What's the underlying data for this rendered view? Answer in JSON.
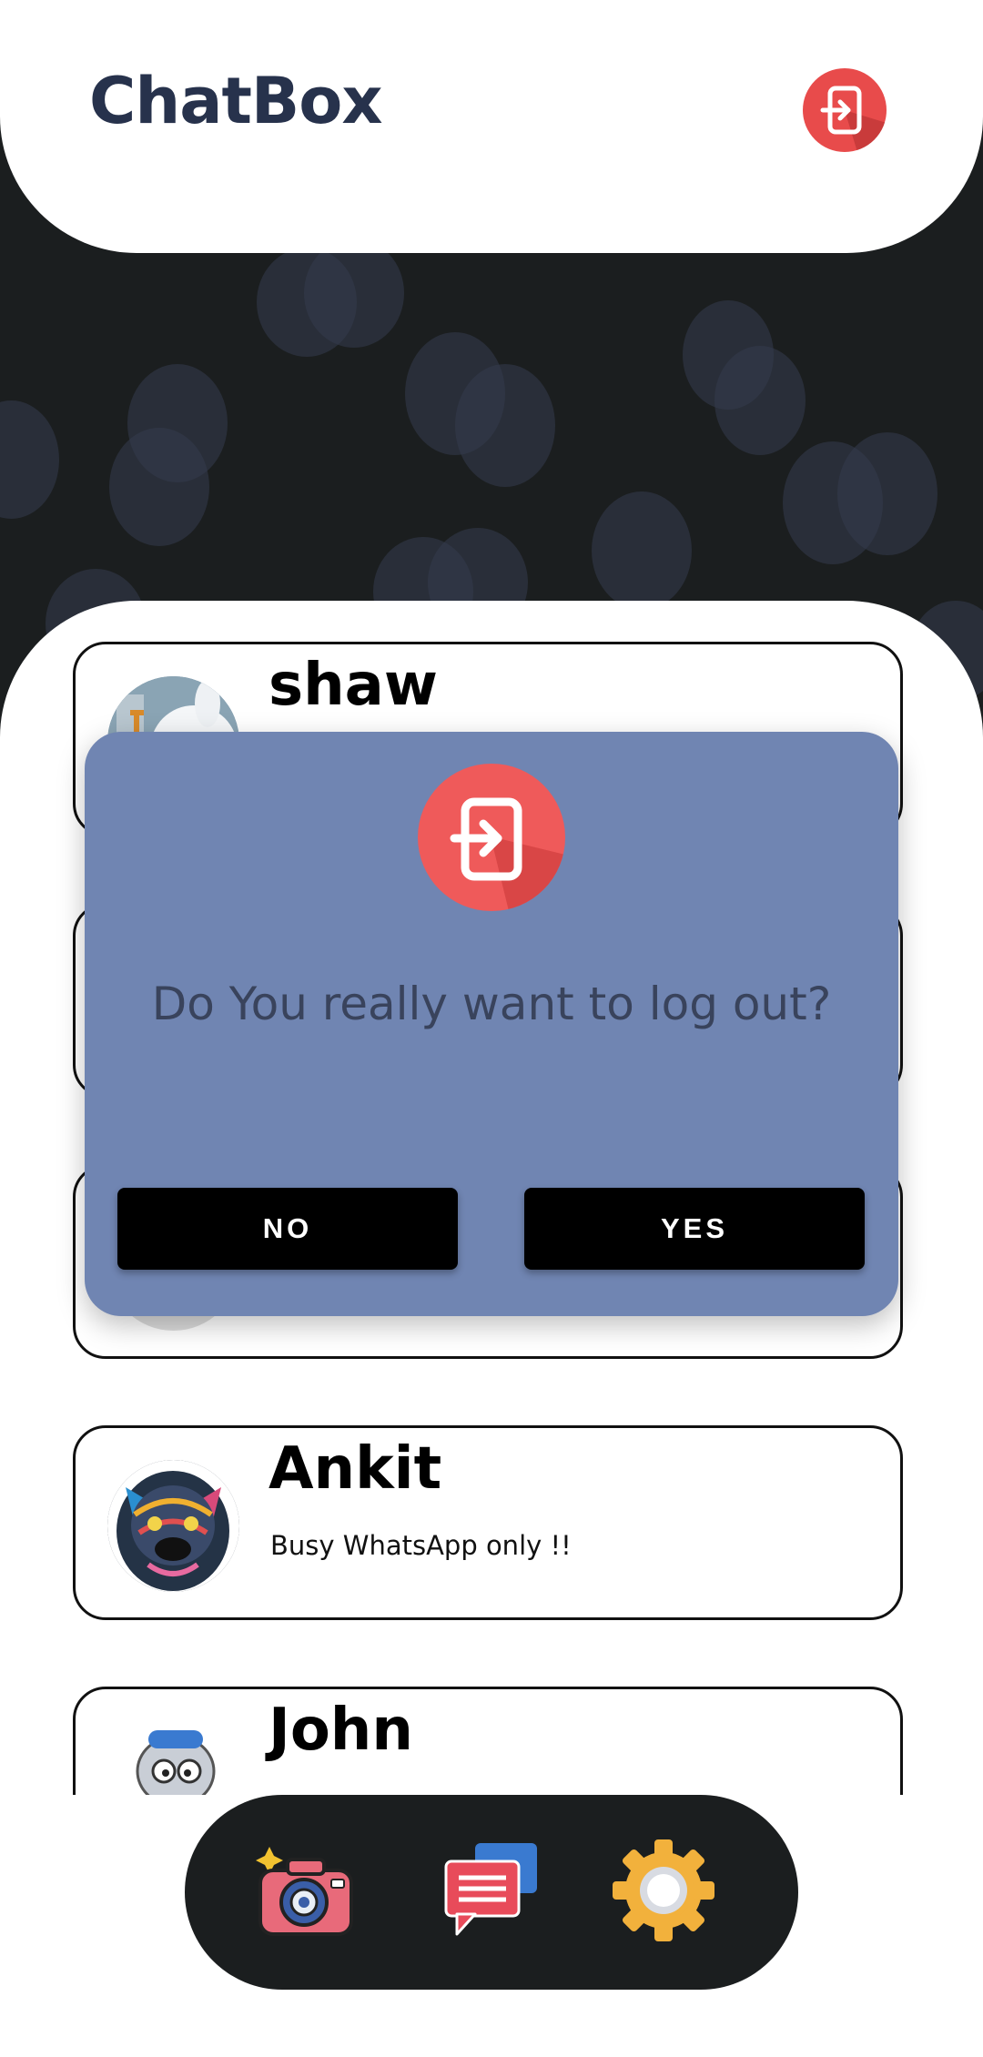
{
  "header": {
    "app_title": "ChatBox",
    "logout_icon": "logout-icon"
  },
  "chats": [
    {
      "name": "shaw",
      "status": "",
      "avatar": "cartoon-rabbit-avatar"
    },
    {
      "name": "",
      "status": "",
      "avatar": ""
    },
    {
      "name": "",
      "status": "",
      "avatar": ""
    },
    {
      "name": "Ankit",
      "status": "Busy WhatsApp only !!",
      "avatar": "colorful-bulldog-avatar"
    },
    {
      "name": "John",
      "status": "",
      "avatar": "robot-avatar"
    }
  ],
  "dialog": {
    "icon": "logout-icon",
    "message": "Do You really want to log out?",
    "no_label": "NO",
    "yes_label": "YES"
  },
  "bottom_nav": {
    "items": [
      {
        "icon": "camera-icon"
      },
      {
        "icon": "chat-bubbles-icon"
      },
      {
        "icon": "settings-gear-icon"
      }
    ]
  },
  "colors": {
    "accent_red": "#e84b4b",
    "dialog_bg": "#7085b2",
    "title_color": "#27324c",
    "dark_bg": "#1b1e1f"
  }
}
